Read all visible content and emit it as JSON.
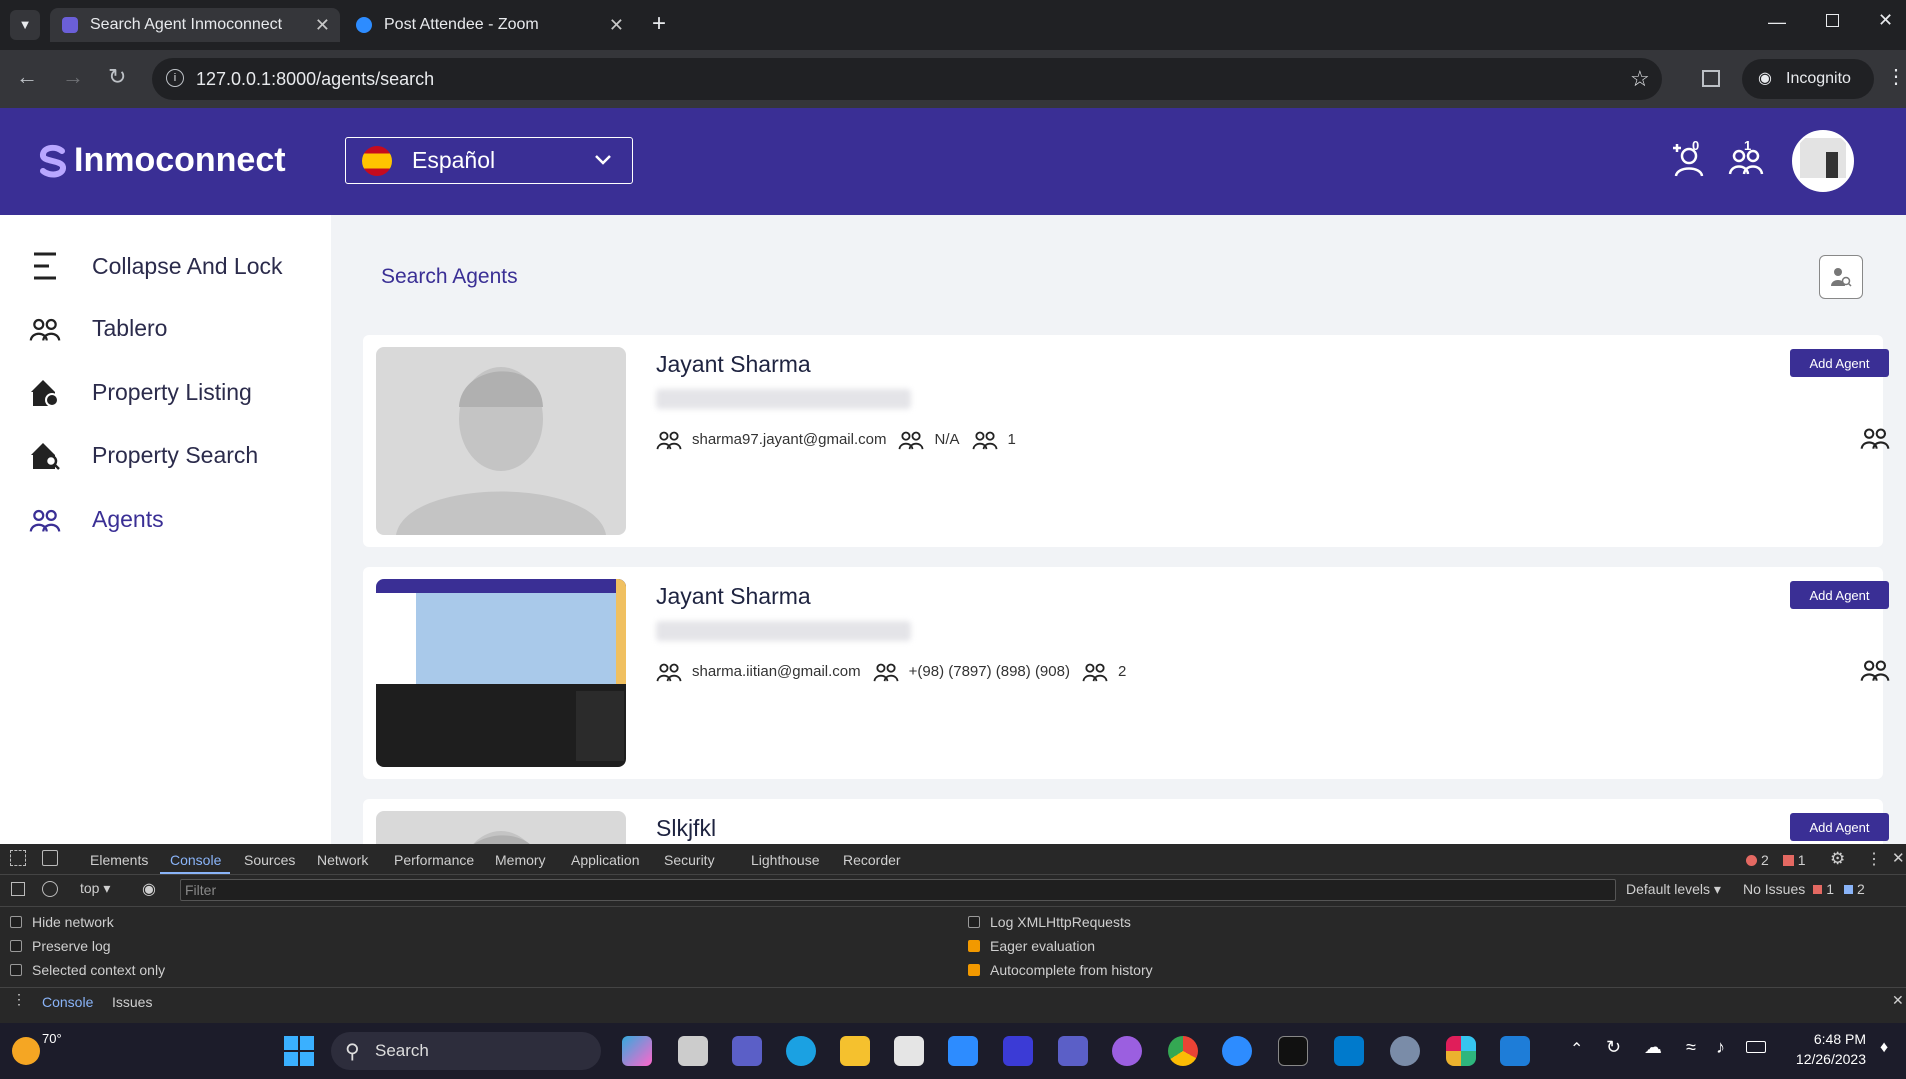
{
  "browser": {
    "tabs": [
      {
        "title": "Search Agent Inmoconnect",
        "active": true
      },
      {
        "title": "Post Attendee - Zoom",
        "active": false
      }
    ],
    "url": "127.0.0.1:8000/agents/search",
    "incognito_label": "Incognito"
  },
  "header": {
    "logo_text": "Inmoconnect",
    "language": "Español",
    "badge_add": "0",
    "badge_group": "1"
  },
  "sidebar": {
    "items": [
      {
        "label": "Collapse And Lock",
        "icon": "menu-icon"
      },
      {
        "label": "Tablero",
        "icon": "group-icon"
      },
      {
        "label": "Property Listing",
        "icon": "house-gear-icon"
      },
      {
        "label": "Property Search",
        "icon": "house-search-icon"
      },
      {
        "label": "Agents",
        "icon": "group-icon"
      }
    ]
  },
  "main": {
    "title": "Search Agents",
    "add_label": "Add Agent",
    "agents": [
      {
        "name": "Jayant Sharma",
        "email": "sharma97.jayant@gmail.com",
        "phone": "N/A",
        "count": "1"
      },
      {
        "name": "Jayant Sharma",
        "email": "sharma.iitian@gmail.com",
        "phone": "+(98) (7897) (898) (908)",
        "count": "2"
      },
      {
        "name": "Slkjfkl",
        "email": "",
        "phone": "",
        "count": ""
      }
    ]
  },
  "devtools": {
    "tabs": [
      "Elements",
      "Console",
      "Sources",
      "Network",
      "Performance",
      "Memory",
      "Application",
      "Security",
      "Lighthouse",
      "Recorder"
    ],
    "errors": "2",
    "warnings": "1",
    "context": "top",
    "filter_placeholder": "Filter",
    "levels": "Default levels",
    "issues_label": "No Issues",
    "issues_red": "1",
    "issues_blue": "2",
    "options_left": [
      {
        "label": "Hide network",
        "checked": false
      },
      {
        "label": "Preserve log",
        "checked": false
      },
      {
        "label": "Selected context only",
        "checked": false
      }
    ],
    "options_right": [
      {
        "label": "Log XMLHttpRequests",
        "checked": false
      },
      {
        "label": "Eager evaluation",
        "checked": true
      },
      {
        "label": "Autocomplete from history",
        "checked": true
      }
    ],
    "drawer_tabs": [
      "Console",
      "Issues"
    ]
  },
  "taskbar": {
    "weather": "70°",
    "search_label": "Search",
    "time": "6:48 PM",
    "date": "12/26/2023"
  }
}
